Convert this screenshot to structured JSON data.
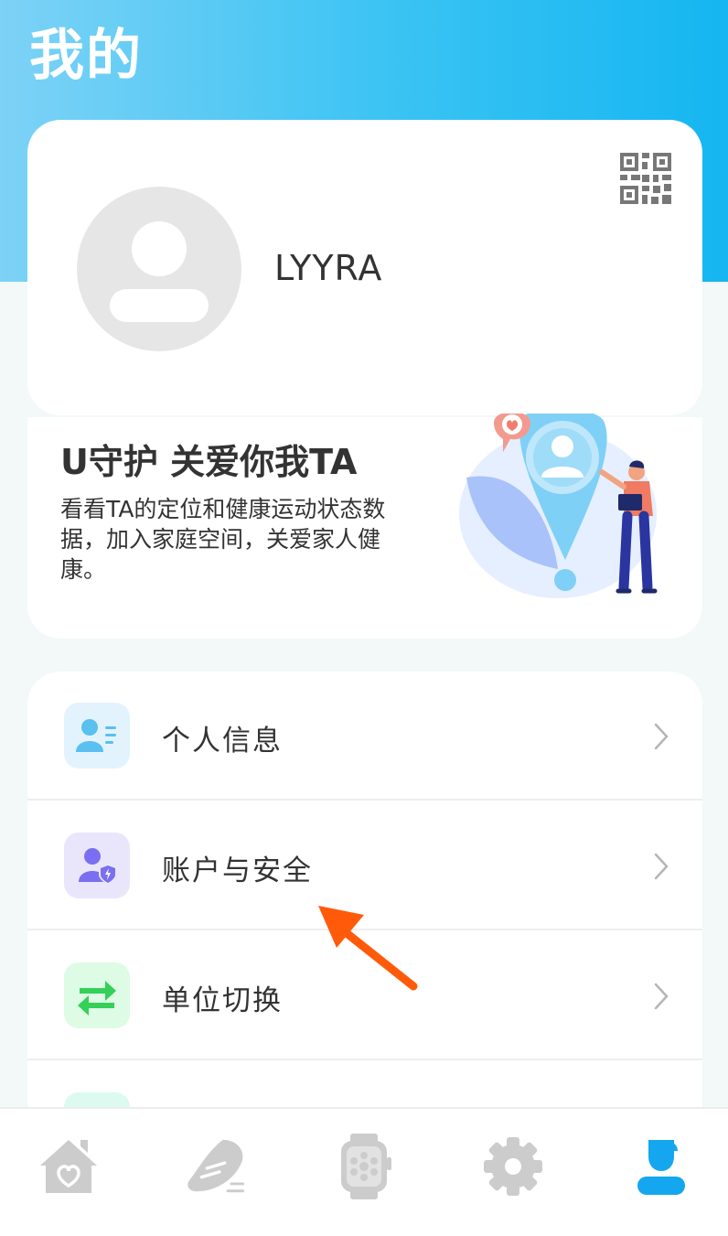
{
  "header": {
    "title": "我的"
  },
  "profile": {
    "username": "LYYRA"
  },
  "promo": {
    "title": "U守护 关爱你我TA",
    "description": "看看TA的定位和健康运动状态数据，加入家庭空间，关爱家人健康。"
  },
  "menu": {
    "items": [
      {
        "label": "个人信息",
        "icon": "user-info-icon",
        "icon_bg": "#e3f3fd",
        "icon_color": "#59c0f0"
      },
      {
        "label": "账户与安全",
        "icon": "account-security-icon",
        "icon_bg": "#e9e6fc",
        "icon_color": "#7a6ff0"
      },
      {
        "label": "单位切换",
        "icon": "unit-switch-icon",
        "icon_bg": "#defbe6",
        "icon_color": "#34d058"
      }
    ]
  },
  "tabbar": {
    "tabs": [
      {
        "icon": "home-heart-icon",
        "active": false
      },
      {
        "icon": "sport-shoe-icon",
        "active": false
      },
      {
        "icon": "watch-icon",
        "active": false
      },
      {
        "icon": "settings-gear-icon",
        "active": false
      },
      {
        "icon": "profile-person-icon",
        "active": true
      }
    ]
  },
  "colors": {
    "accent": "#14a7ef",
    "header_gradient_start": "#7dd2f6",
    "header_gradient_end": "#15b6f1",
    "inactive_icon": "#cccccc",
    "annotation_arrow": "#ff5a0a"
  }
}
